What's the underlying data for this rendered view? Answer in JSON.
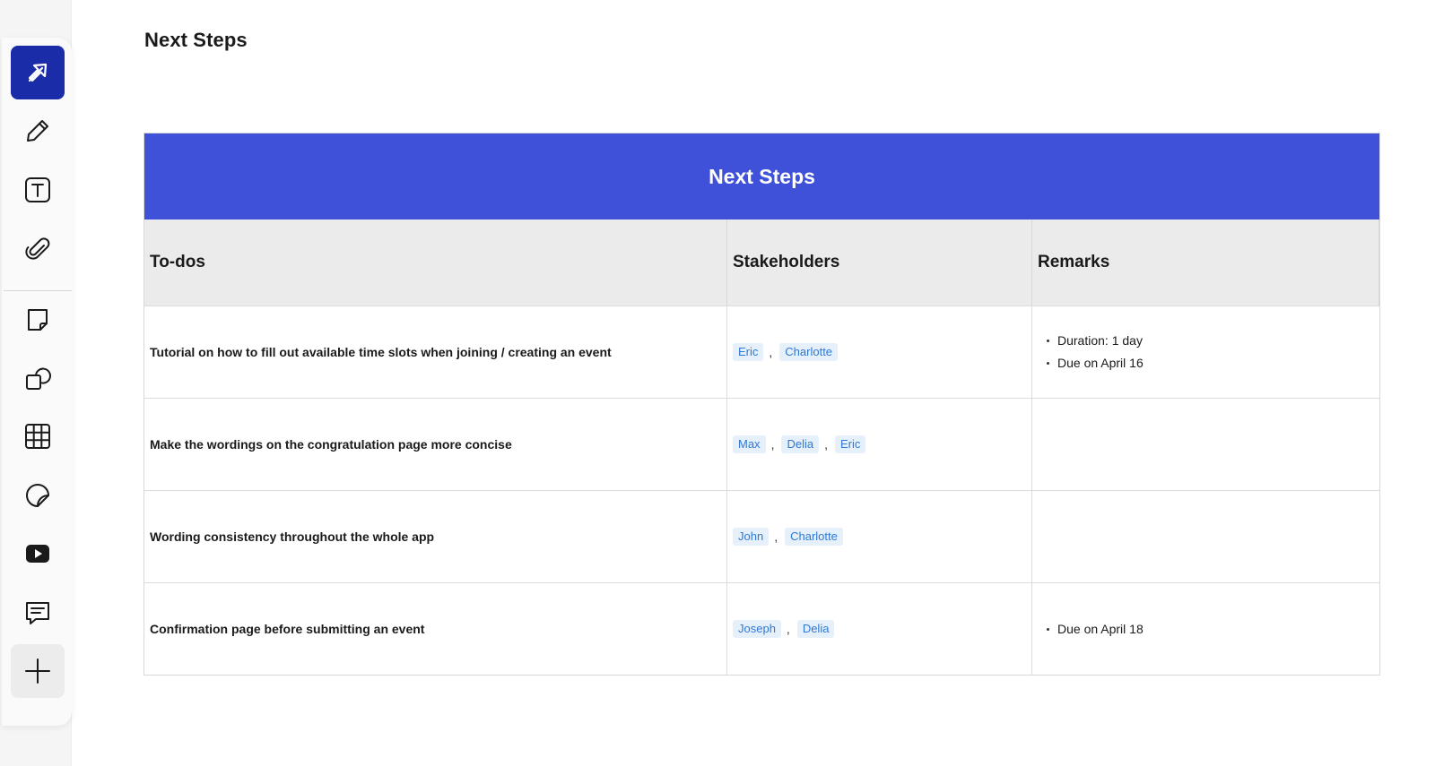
{
  "page": {
    "title": "Next Steps"
  },
  "toolbar": {
    "tools": [
      {
        "name": "select-arrow-icon",
        "active": true
      },
      {
        "name": "pencil-icon"
      },
      {
        "name": "text-icon"
      },
      {
        "name": "paperclip-icon"
      },
      {
        "name": "sticky-note-icon"
      },
      {
        "name": "shapes-icon"
      },
      {
        "name": "table-icon"
      },
      {
        "name": "sticker-icon"
      },
      {
        "name": "video-icon"
      },
      {
        "name": "comment-icon"
      },
      {
        "name": "plus-icon"
      }
    ],
    "active_color": "#1b2ca8"
  },
  "table": {
    "banner_title": "Next Steps",
    "banner_color": "#3f51d8",
    "headers": {
      "todos": "To-dos",
      "stakeholders": "Stakeholders",
      "remarks": "Remarks"
    },
    "rows": [
      {
        "todo": "Tutorial on how to fill out available time slots when joining / creating an event",
        "stakeholders": [
          "Eric",
          "Charlotte"
        ],
        "remarks": [
          "Duration: 1 day",
          "Due on April 16"
        ]
      },
      {
        "todo": "Make the wordings on the congratulation page more concise",
        "stakeholders": [
          "Max",
          "Delia",
          "Eric"
        ],
        "remarks": []
      },
      {
        "todo": "Wording consistency throughout the whole app",
        "stakeholders": [
          "John",
          "Charlotte"
        ],
        "remarks": []
      },
      {
        "todo": "Confirmation page before submitting an event",
        "stakeholders": [
          "Joseph",
          "Delia"
        ],
        "remarks": [
          "Due on April 18"
        ]
      }
    ],
    "separator": ","
  }
}
